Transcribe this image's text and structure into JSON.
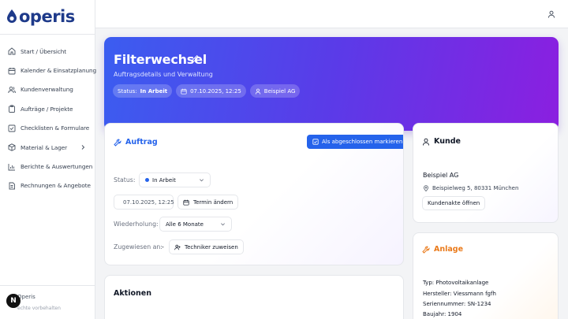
{
  "brand": {
    "name": "operis"
  },
  "sidebar": {
    "items": [
      {
        "label": "Start / Übersicht",
        "icon": "home-icon"
      },
      {
        "label": "Kalender & Einsatzplanung",
        "icon": "calendar-icon"
      },
      {
        "label": "Kundenverwaltung",
        "icon": "users-icon"
      },
      {
        "label": "Aufträge / Projekte",
        "icon": "clipboard-icon"
      },
      {
        "label": "Checklisten & Formulare",
        "icon": "checklist-icon"
      },
      {
        "label": "Material & Lager",
        "icon": "box-icon"
      },
      {
        "label": "Berichte & Auswertungen",
        "icon": "bar-chart-icon"
      },
      {
        "label": "Rechnungen & Angebote",
        "icon": "invoice-icon"
      }
    ],
    "footer_name": "Operis",
    "footer_note": "echte vorbehalten",
    "badge": "N"
  },
  "hero": {
    "title": "Filterwechsel",
    "subtitle": "Auftragsdetails und Verwaltung",
    "status_label": "Status:",
    "status_value": "In Arbeit",
    "date": "07.10.2025, 12:25",
    "customer": "Beispiel AG"
  },
  "auftrag": {
    "title": "Auftrag",
    "complete_button": "Als abgeschlossen markieren",
    "status_label": "Status:",
    "status_value": "In Arbeit",
    "date_value": "07.10.2025, 12:25",
    "reschedule_button": "Termin ändern",
    "repeat_label": "Wiederholung:",
    "repeat_value": "Alle 6 Monate",
    "assigned_label": "Zugewiesen an:",
    "assigned_value": "-",
    "assign_button": "Techniker zuweisen"
  },
  "aktionen": {
    "title": "Aktionen"
  },
  "kunde": {
    "title": "Kunde",
    "name": "Beispiel AG",
    "address": "Beispielweg 5, 80331 München",
    "open_button": "Kundenakte öffnen"
  },
  "anlage": {
    "title": "Anlage",
    "type": "Typ: Photovoltaikanlage",
    "manufacturer": "Hersteller: Viessmann fgfh",
    "serial": "Seriennummer: SN-1234",
    "year": "Baujahr: 1904"
  },
  "colors": {
    "primary": "#2563eb",
    "anlage_accent": "#ea7a1a",
    "hero_start": "#3b5df0",
    "hero_end": "#8b1fe0"
  }
}
